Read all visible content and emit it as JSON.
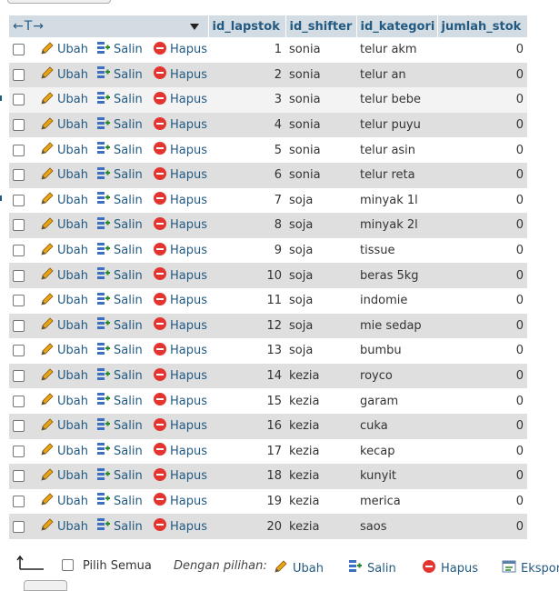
{
  "header": {
    "arrows_label": "←T→",
    "columns": [
      "id_lapstok",
      "id_shifter",
      "id_kategori",
      "jumlah_stok"
    ]
  },
  "row_actions": {
    "edit": "Ubah",
    "copy": "Salin",
    "delete": "Hapus"
  },
  "rows": [
    {
      "id": "1",
      "shifter": "sonia",
      "kategori": "telur akm",
      "stok": "0"
    },
    {
      "id": "2",
      "shifter": "sonia",
      "kategori": "telur an",
      "stok": "0"
    },
    {
      "id": "3",
      "shifter": "sonia",
      "kategori": "telur bebe",
      "stok": "0"
    },
    {
      "id": "4",
      "shifter": "sonia",
      "kategori": "telur puyu",
      "stok": "0"
    },
    {
      "id": "5",
      "shifter": "sonia",
      "kategori": "telur asin",
      "stok": "0"
    },
    {
      "id": "6",
      "shifter": "sonia",
      "kategori": "telur reta",
      "stok": "0"
    },
    {
      "id": "7",
      "shifter": "soja",
      "kategori": "minyak 1l",
      "stok": "0"
    },
    {
      "id": "8",
      "shifter": "soja",
      "kategori": "minyak 2l",
      "stok": "0"
    },
    {
      "id": "9",
      "shifter": "soja",
      "kategori": "tissue",
      "stok": "0"
    },
    {
      "id": "10",
      "shifter": "soja",
      "kategori": "beras 5kg",
      "stok": "0"
    },
    {
      "id": "11",
      "shifter": "soja",
      "kategori": "indomie",
      "stok": "0"
    },
    {
      "id": "12",
      "shifter": "soja",
      "kategori": "mie sedap",
      "stok": "0"
    },
    {
      "id": "13",
      "shifter": "soja",
      "kategori": "bumbu",
      "stok": "0"
    },
    {
      "id": "14",
      "shifter": "kezia",
      "kategori": "royco",
      "stok": "0"
    },
    {
      "id": "15",
      "shifter": "kezia",
      "kategori": "garam",
      "stok": "0"
    },
    {
      "id": "16",
      "shifter": "kezia",
      "kategori": "cuka",
      "stok": "0"
    },
    {
      "id": "17",
      "shifter": "kezia",
      "kategori": "kecap",
      "stok": "0"
    },
    {
      "id": "18",
      "shifter": "kezia",
      "kategori": "kunyit",
      "stok": "0"
    },
    {
      "id": "19",
      "shifter": "kezia",
      "kategori": "merica",
      "stok": "0"
    },
    {
      "id": "20",
      "shifter": "kezia",
      "kategori": "saos",
      "stok": "0"
    }
  ],
  "footer": {
    "select_all": "Pilih Semua",
    "with_selected": "Dengan pilihan:",
    "edit": "Ubah",
    "copy": "Salin",
    "delete": "Hapus",
    "export": "Ekspor"
  },
  "colors": {
    "link": "#235a81",
    "header_bg": "#d3dce3",
    "row_even": "#dfdfdf",
    "delete_icon": "#e3342f",
    "pencil": "#e8a317"
  }
}
